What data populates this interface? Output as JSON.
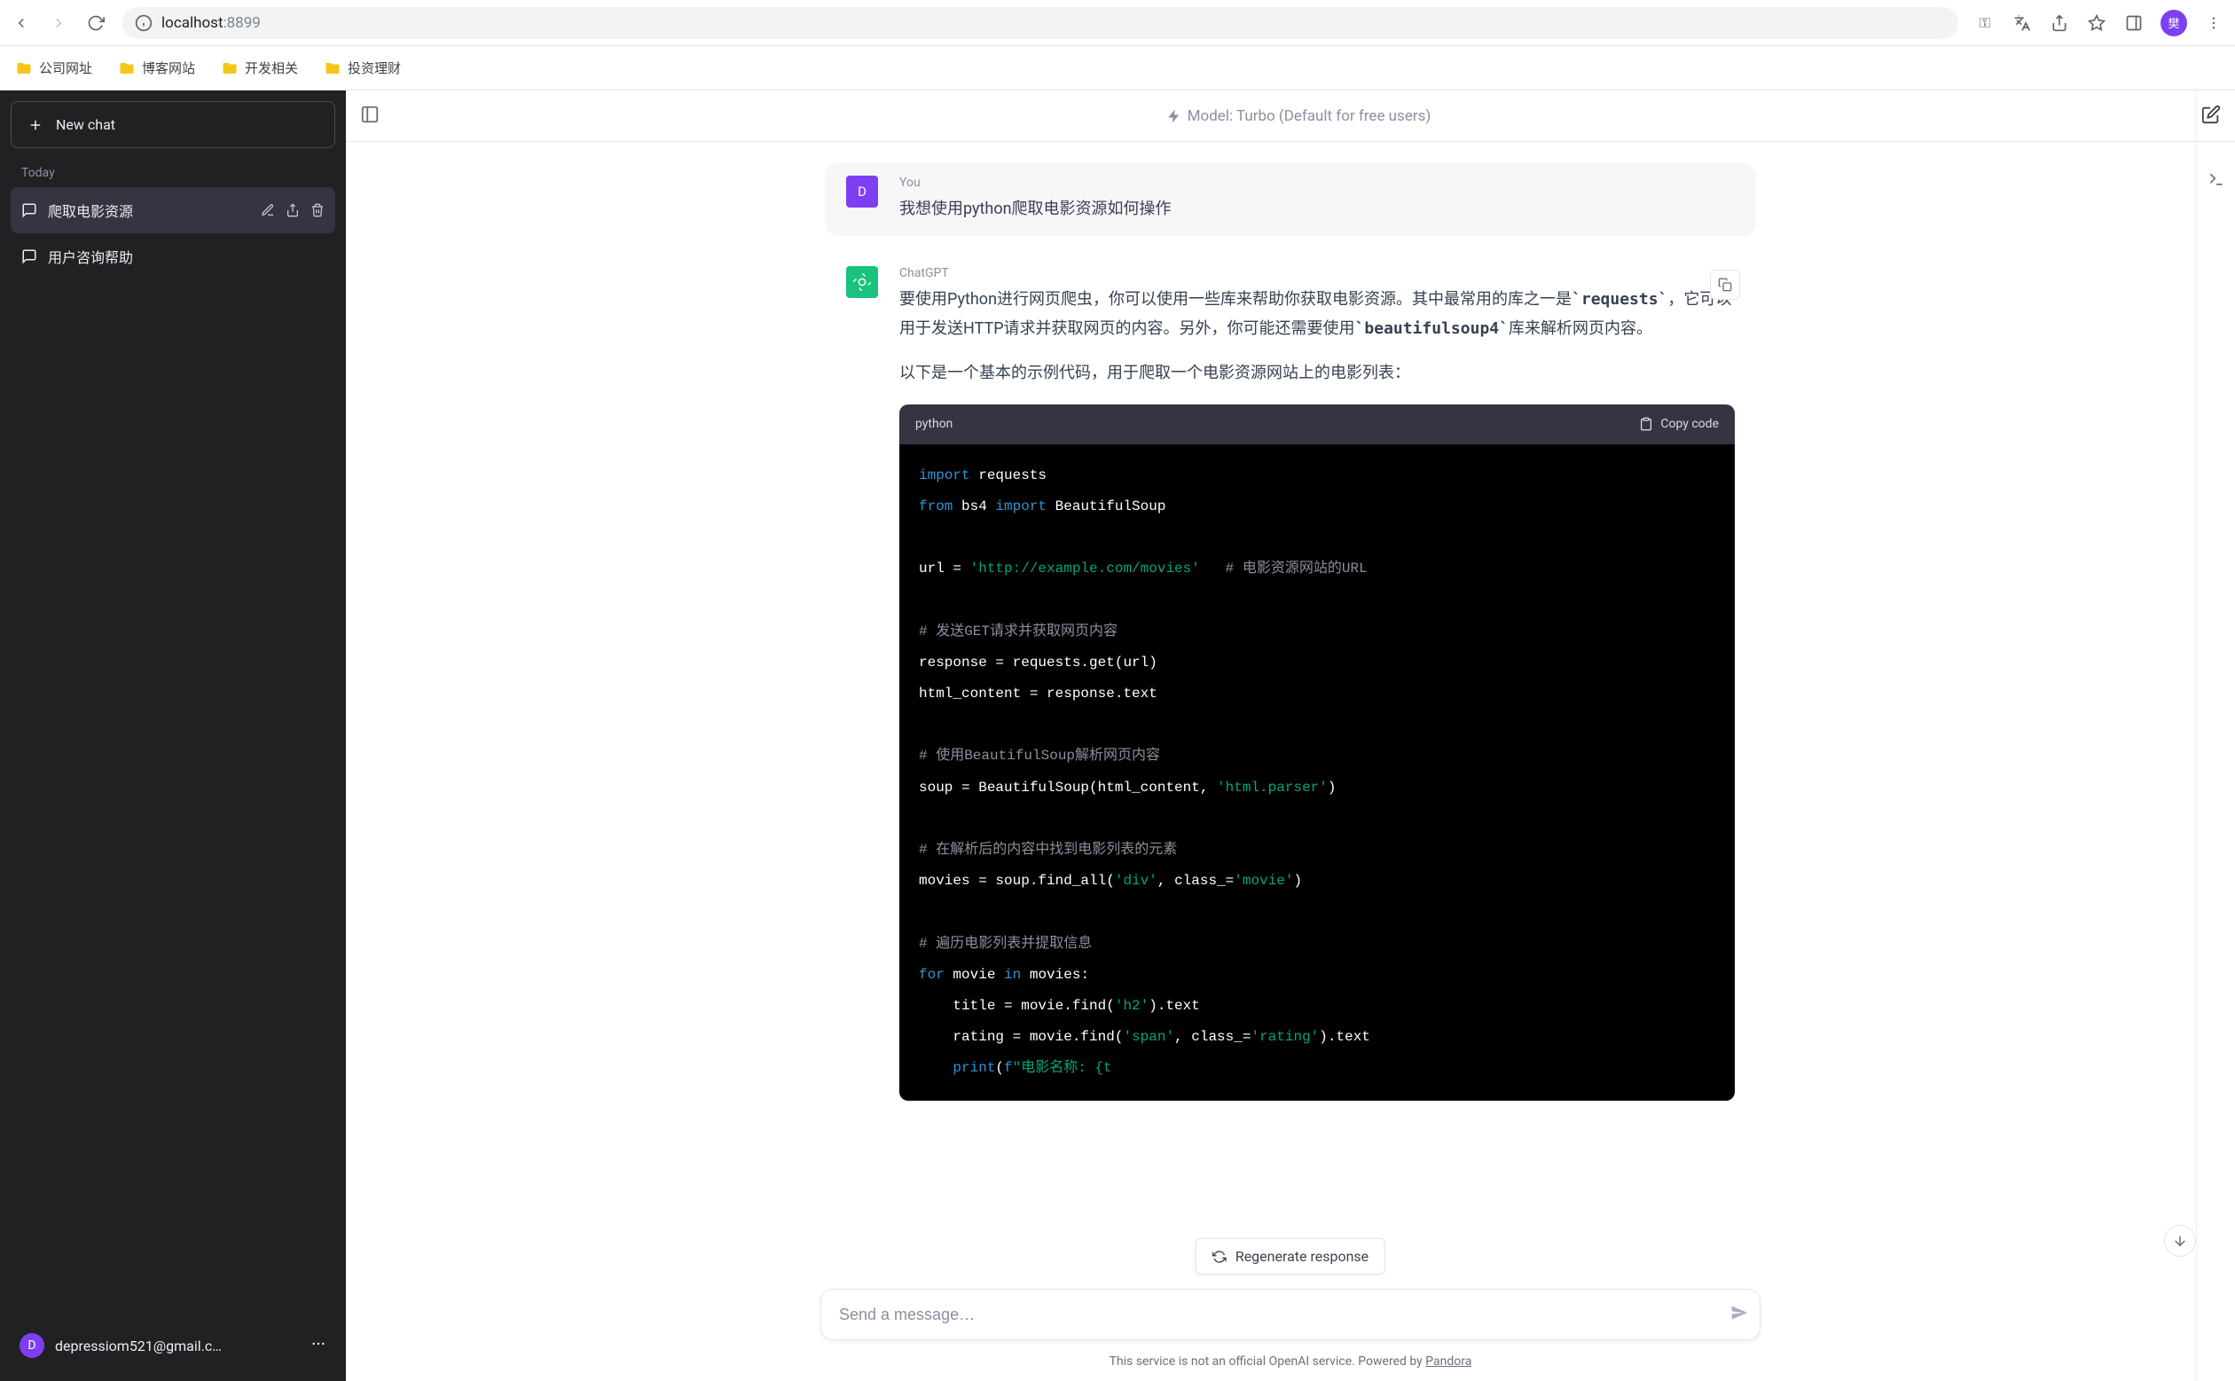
{
  "browser": {
    "url_host": "localhost",
    "url_port": ":8899",
    "avatar_initial": "樊"
  },
  "bookmarks": [
    "公司网址",
    "博客网站",
    "开发相关",
    "投资理财"
  ],
  "sidebar": {
    "new_chat": "New chat",
    "section": "Today",
    "chats": [
      {
        "title": "爬取电影资源",
        "active": true
      },
      {
        "title": "用户咨询帮助",
        "active": false
      }
    ],
    "user_email": "depressiom521@gmail.c…",
    "user_initial": "D"
  },
  "header": {
    "model": "Model: Turbo (Default for free users)"
  },
  "messages": {
    "user": {
      "sender": "You",
      "avatar": "D",
      "text": "我想使用python爬取电影资源如何操作"
    },
    "bot": {
      "sender": "ChatGPT",
      "para1_before": "要使用Python进行网页爬虫，你可以使用一些库来帮助你获取电影资源。其中最常用的库之一是",
      "code1": "`requests`",
      "para1_mid": "，它可以用于发送HTTP请求并获取网页的内容。另外，你可能还需要使用",
      "code2": "`beautifulsoup4`",
      "para1_after": "库来解析网页内容。",
      "para2": "以下是一个基本的示例代码，用于爬取一个电影资源网站上的电影列表："
    }
  },
  "code": {
    "lang": "python",
    "copy_label": "Copy code",
    "lines": [
      {
        "t": "import",
        "k": "kw"
      },
      {
        "t": " requests\n",
        "k": "mod"
      },
      {
        "t": "from",
        "k": "kw"
      },
      {
        "t": " bs4 ",
        "k": "mod"
      },
      {
        "t": "import",
        "k": "kw"
      },
      {
        "t": " BeautifulSoup\n\n",
        "k": "mod"
      },
      {
        "t": "url = ",
        "k": "mod"
      },
      {
        "t": "'http://example.com/movies'",
        "k": "str"
      },
      {
        "t": "   ",
        "k": "mod"
      },
      {
        "t": "# 电影资源网站的URL\n\n",
        "k": "cmt"
      },
      {
        "t": "# 发送GET请求并获取网页内容\n",
        "k": "cmt"
      },
      {
        "t": "response = requests.get(url)\n",
        "k": "mod"
      },
      {
        "t": "html_content = response.text\n\n",
        "k": "mod"
      },
      {
        "t": "# 使用BeautifulSoup解析网页内容\n",
        "k": "cmt"
      },
      {
        "t": "soup = BeautifulSoup(html_content, ",
        "k": "mod"
      },
      {
        "t": "'html.parser'",
        "k": "str"
      },
      {
        "t": ")\n\n",
        "k": "mod"
      },
      {
        "t": "# 在解析后的内容中找到电影列表的元素\n",
        "k": "cmt"
      },
      {
        "t": "movies = soup.find_all(",
        "k": "mod"
      },
      {
        "t": "'div'",
        "k": "str"
      },
      {
        "t": ", class_=",
        "k": "mod"
      },
      {
        "t": "'movie'",
        "k": "str"
      },
      {
        "t": ")\n\n",
        "k": "mod"
      },
      {
        "t": "# 遍历电影列表并提取信息\n",
        "k": "cmt"
      },
      {
        "t": "for",
        "k": "kw"
      },
      {
        "t": " movie ",
        "k": "mod"
      },
      {
        "t": "in",
        "k": "kw"
      },
      {
        "t": " movies:\n",
        "k": "mod"
      },
      {
        "t": "    title = movie.find(",
        "k": "mod"
      },
      {
        "t": "'h2'",
        "k": "str"
      },
      {
        "t": ").text\n",
        "k": "mod"
      },
      {
        "t": "    rating = movie.find(",
        "k": "mod"
      },
      {
        "t": "'span'",
        "k": "str"
      },
      {
        "t": ", class_=",
        "k": "mod"
      },
      {
        "t": "'rating'",
        "k": "str"
      },
      {
        "t": ").text\n",
        "k": "mod"
      },
      {
        "t": "    ",
        "k": "mod"
      },
      {
        "t": "print",
        "k": "print"
      },
      {
        "t": "(",
        "k": "mod"
      },
      {
        "t": "f",
        "k": "kw"
      },
      {
        "t": "\"电影名称: {t",
        "k": "str"
      }
    ]
  },
  "regen_label": "Regenerate response",
  "input_placeholder": "Send a message…",
  "footer": {
    "text": "This service is not an official OpenAI service. Powered by ",
    "link": "Pandora"
  }
}
